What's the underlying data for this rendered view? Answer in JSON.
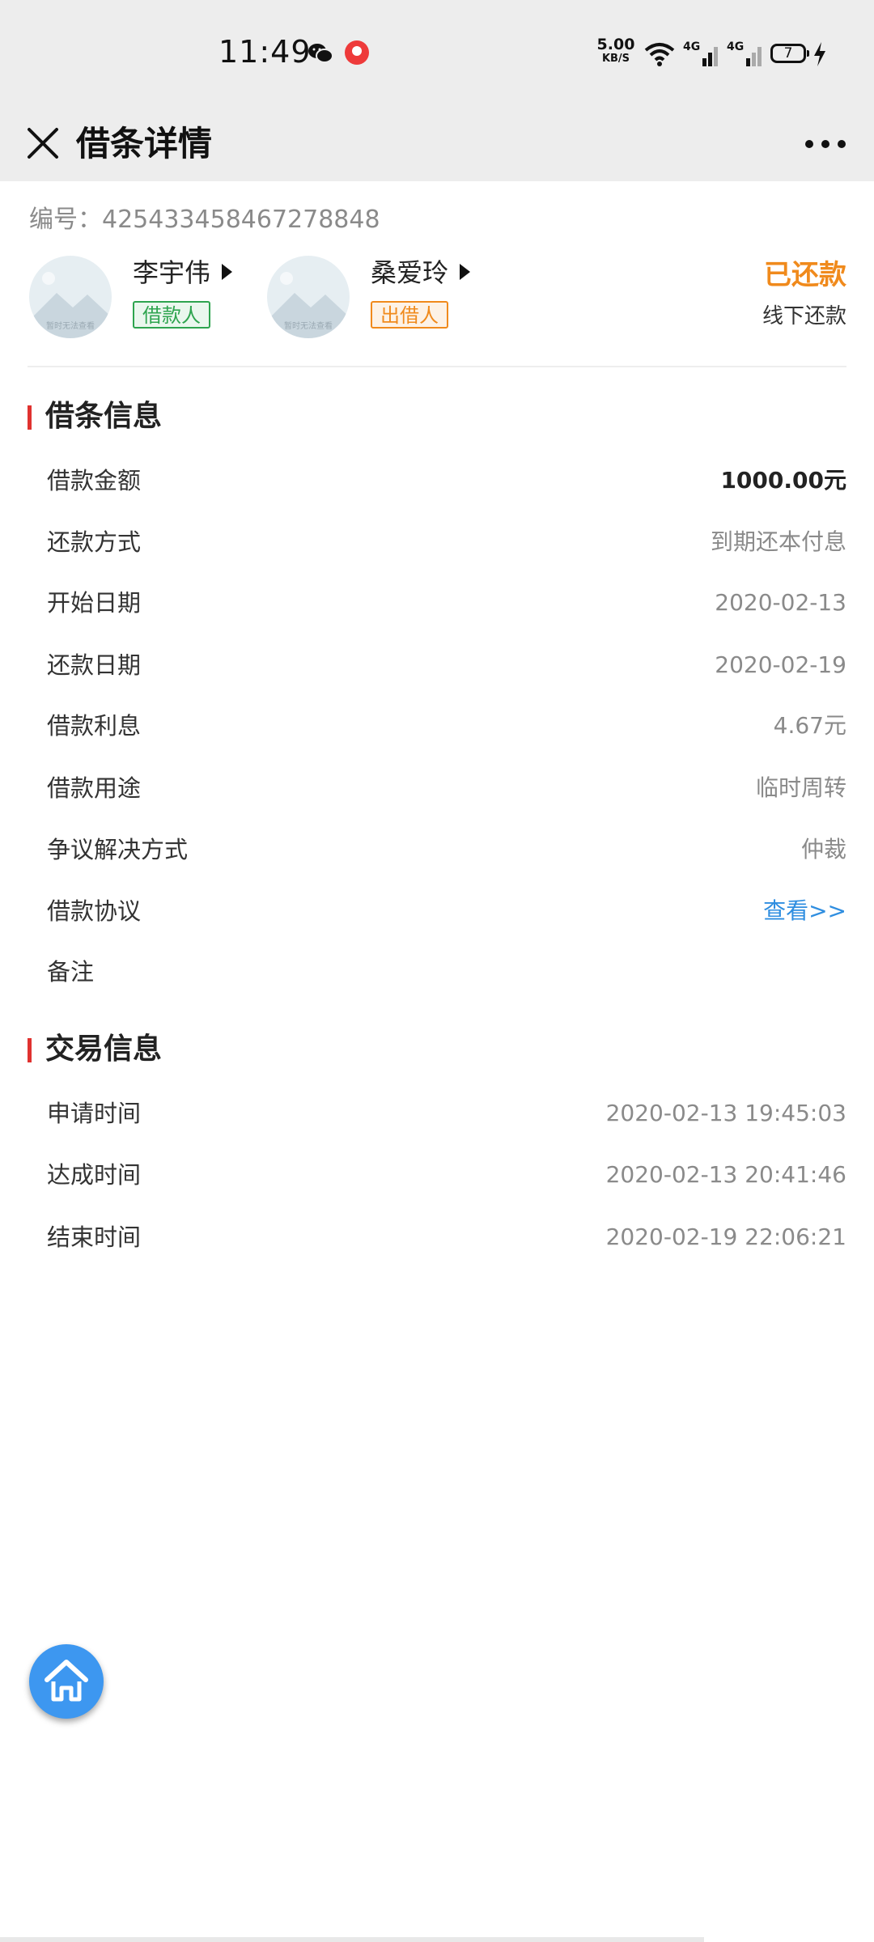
{
  "status_bar": {
    "time": "11:49",
    "net_speed": "5.00",
    "net_speed_unit": "KB/S",
    "signal_1": "4G",
    "signal_2": "4G",
    "battery": "7"
  },
  "nav": {
    "title": "借条详情",
    "close_icon": "close-icon",
    "more_icon": "more-icon"
  },
  "header": {
    "serial": "编号：425433458467278848",
    "borrower": {
      "name": "李宇伟",
      "role": "借款人"
    },
    "lender": {
      "name": "桑爱玲",
      "role": "出借人"
    },
    "avatar_placeholder_text": "暂时无法查看",
    "status": "已还款",
    "status_sub": "线下还款"
  },
  "loan_info": {
    "title": "借条信息",
    "rows": [
      {
        "label": "借款金额",
        "value": "1000.00元"
      },
      {
        "label": "还款方式",
        "value": "到期还本付息"
      },
      {
        "label": "开始日期",
        "value": "2020-02-13"
      },
      {
        "label": "还款日期",
        "value": "2020-02-19"
      },
      {
        "label": "借款利息",
        "value": "4.67元"
      },
      {
        "label": "借款用途",
        "value": "临时周转"
      },
      {
        "label": "争议解决方式",
        "value": "仲裁"
      },
      {
        "label": "借款协议",
        "value": "查看>>"
      },
      {
        "label": "备注",
        "value": ""
      }
    ]
  },
  "trade_info": {
    "title": "交易信息",
    "rows": [
      {
        "label": "申请时间",
        "value": "2020-02-13 19:45:03"
      },
      {
        "label": "达成时间",
        "value": "2020-02-13 20:41:46"
      },
      {
        "label": "结束时间",
        "value": "2020-02-19 22:06:21"
      }
    ]
  },
  "colors": {
    "accent_red": "#e0322f",
    "status_orange": "#f08a1c",
    "borrower_green": "#2ea44f",
    "link_blue": "#2f8ee0",
    "fab_blue": "#3d97f0"
  }
}
